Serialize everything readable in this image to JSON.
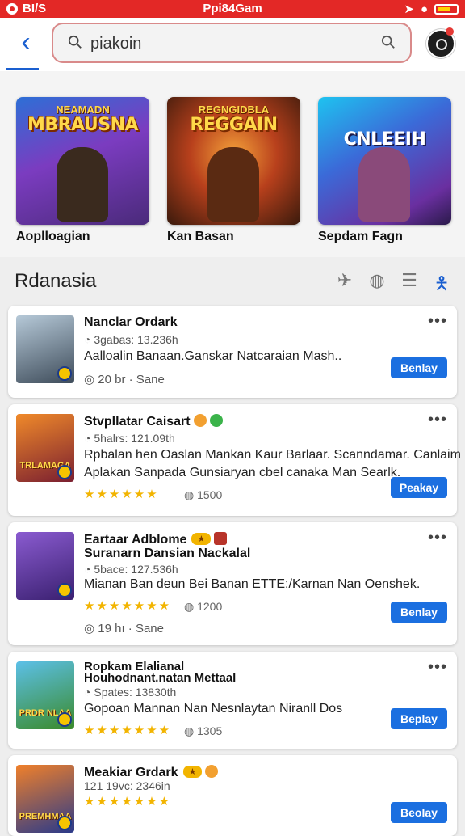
{
  "status_bar": {
    "left_text": "BI/S",
    "center_text": "Ppi84Gam"
  },
  "search": {
    "value": "piakoin",
    "placeholder": "piakoin"
  },
  "featured": [
    {
      "art_subtitle": "NEAMADN",
      "art_title": "MBRAUSNA",
      "label": "Aoplloagian"
    },
    {
      "art_subtitle": "REGNGIDBLA",
      "art_title": "REGGAIN",
      "label": "Kan Basan"
    },
    {
      "art_subtitle": "",
      "art_title": "CNLEEIH",
      "label": "Sepdam Fagn"
    }
  ],
  "section": {
    "title": "Rdanasia"
  },
  "apps": [
    {
      "name": "Nanclar Ordark",
      "name2": "",
      "meta": "3gabas: 13.236h",
      "desc_lines": [
        "Aalloalin Banaan.Ganskar Natcaraian Mash.."
      ],
      "rating": "",
      "count": "",
      "age": "20 br · Sane",
      "thumb_text": "",
      "button": "Benlay"
    },
    {
      "name": "Stvpllatar Caisart",
      "name2": "",
      "meta": "5halrs: 121.09th",
      "desc_lines": [
        "Rpbalan hen Oaslan Mankan Kaur Barlaar. Scanndamar. Canlaim",
        "Aplakan Sanpada Gunsiaryan cbel canaka Man Searlk."
      ],
      "rating": "★★★★★★",
      "count": "1500",
      "age": "",
      "thumb_text": "TRLAMAGA",
      "button": "Peakay"
    },
    {
      "name": "Eartaar Adblome",
      "name2": "Suranarn Dansian Nackalal",
      "meta": "5bace: 127.536h",
      "desc_lines": [
        "Mianan Ban deun Bei Banan ETTE:/Karnan Nan Oenshek."
      ],
      "rating": "★★★★★★★",
      "count": "1200",
      "age": "19 hı · Sane",
      "thumb_text": "",
      "button": "Benlay"
    },
    {
      "name": "Ropkam Elalianal Houhodnant.natan Mettaal",
      "name2": "",
      "meta": "Spates: 13830th",
      "desc_lines": [
        "Gopoan Mannan Nan Nesnlaytan Niranll Dos"
      ],
      "rating": "★★★★★★★",
      "count": "1305",
      "age": "",
      "thumb_text": "PRDR NLAA",
      "button": "Beplay"
    },
    {
      "name": "Meakiar Grdark",
      "name2": "",
      "meta": "121 19vc: 2346in",
      "desc_lines": [],
      "rating": "★★★★★★★",
      "count": "",
      "age": "",
      "thumb_text": "PREMHMAA",
      "button": "Beolay"
    }
  ]
}
